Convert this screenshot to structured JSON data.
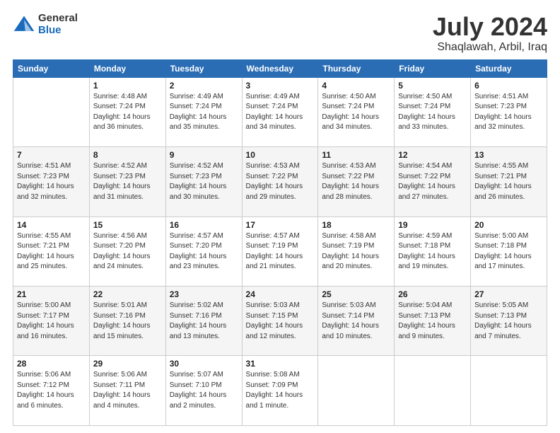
{
  "header": {
    "logo_general": "General",
    "logo_blue": "Blue",
    "title": "July 2024",
    "location": "Shaqlawah, Arbil, Iraq"
  },
  "days_of_week": [
    "Sunday",
    "Monday",
    "Tuesday",
    "Wednesday",
    "Thursday",
    "Friday",
    "Saturday"
  ],
  "weeks": [
    [
      {
        "day": "",
        "info": ""
      },
      {
        "day": "1",
        "info": "Sunrise: 4:48 AM\nSunset: 7:24 PM\nDaylight: 14 hours\nand 36 minutes."
      },
      {
        "day": "2",
        "info": "Sunrise: 4:49 AM\nSunset: 7:24 PM\nDaylight: 14 hours\nand 35 minutes."
      },
      {
        "day": "3",
        "info": "Sunrise: 4:49 AM\nSunset: 7:24 PM\nDaylight: 14 hours\nand 34 minutes."
      },
      {
        "day": "4",
        "info": "Sunrise: 4:50 AM\nSunset: 7:24 PM\nDaylight: 14 hours\nand 34 minutes."
      },
      {
        "day": "5",
        "info": "Sunrise: 4:50 AM\nSunset: 7:24 PM\nDaylight: 14 hours\nand 33 minutes."
      },
      {
        "day": "6",
        "info": "Sunrise: 4:51 AM\nSunset: 7:23 PM\nDaylight: 14 hours\nand 32 minutes."
      }
    ],
    [
      {
        "day": "7",
        "info": "Sunrise: 4:51 AM\nSunset: 7:23 PM\nDaylight: 14 hours\nand 32 minutes."
      },
      {
        "day": "8",
        "info": "Sunrise: 4:52 AM\nSunset: 7:23 PM\nDaylight: 14 hours\nand 31 minutes."
      },
      {
        "day": "9",
        "info": "Sunrise: 4:52 AM\nSunset: 7:23 PM\nDaylight: 14 hours\nand 30 minutes."
      },
      {
        "day": "10",
        "info": "Sunrise: 4:53 AM\nSunset: 7:22 PM\nDaylight: 14 hours\nand 29 minutes."
      },
      {
        "day": "11",
        "info": "Sunrise: 4:53 AM\nSunset: 7:22 PM\nDaylight: 14 hours\nand 28 minutes."
      },
      {
        "day": "12",
        "info": "Sunrise: 4:54 AM\nSunset: 7:22 PM\nDaylight: 14 hours\nand 27 minutes."
      },
      {
        "day": "13",
        "info": "Sunrise: 4:55 AM\nSunset: 7:21 PM\nDaylight: 14 hours\nand 26 minutes."
      }
    ],
    [
      {
        "day": "14",
        "info": "Sunrise: 4:55 AM\nSunset: 7:21 PM\nDaylight: 14 hours\nand 25 minutes."
      },
      {
        "day": "15",
        "info": "Sunrise: 4:56 AM\nSunset: 7:20 PM\nDaylight: 14 hours\nand 24 minutes."
      },
      {
        "day": "16",
        "info": "Sunrise: 4:57 AM\nSunset: 7:20 PM\nDaylight: 14 hours\nand 23 minutes."
      },
      {
        "day": "17",
        "info": "Sunrise: 4:57 AM\nSunset: 7:19 PM\nDaylight: 14 hours\nand 21 minutes."
      },
      {
        "day": "18",
        "info": "Sunrise: 4:58 AM\nSunset: 7:19 PM\nDaylight: 14 hours\nand 20 minutes."
      },
      {
        "day": "19",
        "info": "Sunrise: 4:59 AM\nSunset: 7:18 PM\nDaylight: 14 hours\nand 19 minutes."
      },
      {
        "day": "20",
        "info": "Sunrise: 5:00 AM\nSunset: 7:18 PM\nDaylight: 14 hours\nand 17 minutes."
      }
    ],
    [
      {
        "day": "21",
        "info": "Sunrise: 5:00 AM\nSunset: 7:17 PM\nDaylight: 14 hours\nand 16 minutes."
      },
      {
        "day": "22",
        "info": "Sunrise: 5:01 AM\nSunset: 7:16 PM\nDaylight: 14 hours\nand 15 minutes."
      },
      {
        "day": "23",
        "info": "Sunrise: 5:02 AM\nSunset: 7:16 PM\nDaylight: 14 hours\nand 13 minutes."
      },
      {
        "day": "24",
        "info": "Sunrise: 5:03 AM\nSunset: 7:15 PM\nDaylight: 14 hours\nand 12 minutes."
      },
      {
        "day": "25",
        "info": "Sunrise: 5:03 AM\nSunset: 7:14 PM\nDaylight: 14 hours\nand 10 minutes."
      },
      {
        "day": "26",
        "info": "Sunrise: 5:04 AM\nSunset: 7:13 PM\nDaylight: 14 hours\nand 9 minutes."
      },
      {
        "day": "27",
        "info": "Sunrise: 5:05 AM\nSunset: 7:13 PM\nDaylight: 14 hours\nand 7 minutes."
      }
    ],
    [
      {
        "day": "28",
        "info": "Sunrise: 5:06 AM\nSunset: 7:12 PM\nDaylight: 14 hours\nand 6 minutes."
      },
      {
        "day": "29",
        "info": "Sunrise: 5:06 AM\nSunset: 7:11 PM\nDaylight: 14 hours\nand 4 minutes."
      },
      {
        "day": "30",
        "info": "Sunrise: 5:07 AM\nSunset: 7:10 PM\nDaylight: 14 hours\nand 2 minutes."
      },
      {
        "day": "31",
        "info": "Sunrise: 5:08 AM\nSunset: 7:09 PM\nDaylight: 14 hours\nand 1 minute."
      },
      {
        "day": "",
        "info": ""
      },
      {
        "day": "",
        "info": ""
      },
      {
        "day": "",
        "info": ""
      }
    ]
  ]
}
